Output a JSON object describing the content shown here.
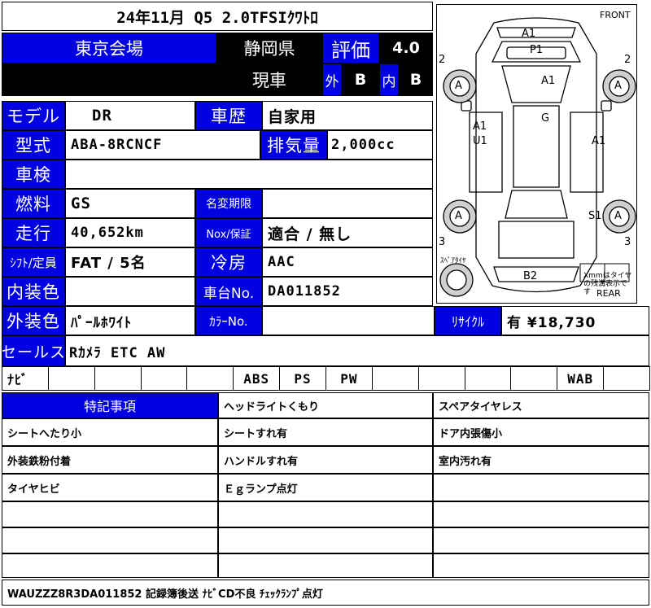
{
  "header": {
    "title": "24年11月 Q5 2.0TFSIｸﾜﾄﾛ"
  },
  "auction": {
    "venue": "東京会場",
    "prefecture": "静岡県",
    "grade_label": "評価",
    "grade": "4.0",
    "status": "現車",
    "exterior_label": "外",
    "exterior": "B",
    "interior_label": "内",
    "interior": "B"
  },
  "spec": {
    "model_label": "モデル",
    "model": "DR",
    "history_label": "車歴",
    "history": "自家用",
    "type_label": "型式",
    "type": "ABA-8RCNCF",
    "displacement_label": "排気量",
    "displacement": "2,000cc",
    "inspection_label": "車検",
    "inspection": "",
    "fuel_label": "燃料",
    "fuel": "GS",
    "transfer_label": "名変期限",
    "transfer": "",
    "mileage_label": "走行",
    "mileage": "40,652km",
    "nox_label": "Nox/保証",
    "nox": "適合 / 無し",
    "shift_label": "ｼﾌﾄ/定員",
    "shift": "FAT / 5名",
    "ac_label": "冷房",
    "ac": "AAC",
    "interior_color_label": "内装色",
    "interior_color": "",
    "chassis_label": "車台No.",
    "chassis": "DA011852",
    "exterior_color_label": "外装色",
    "exterior_color": "ﾊﾟｰﾙﾎﾜｲﾄ",
    "color_no_label": "ｶﾗｰNo.",
    "color_no": "",
    "recycle_label": "ﾘｻｲｸﾙ",
    "recycle": "有 ¥18,730",
    "sales_label": "セールス",
    "sales": "Rｶﾒﾗ ETC AW"
  },
  "equipment": [
    "ﾅﾋﾞ",
    "",
    "",
    "",
    "",
    "ABS",
    "PS",
    "PW",
    "",
    "",
    "",
    "",
    "WAB",
    ""
  ],
  "notes": {
    "header": "特記事項",
    "items": [
      "ヘッドライトくもり",
      "スペアタイヤレス",
      "シートへたり小",
      "シートすれ有",
      "ドア内張傷小",
      "外装鉄粉付着",
      "ハンドルすれ有",
      "室内汚れ有",
      "タイヤヒビ",
      "Ｅｇランプ点灯",
      ""
    ]
  },
  "footer": {
    "remarks": "WAUZZZ8R3DA011852 記録簿後送 ﾅﾋﾞCD不良 ﾁｪｯｸﾗﾝﾌﾟ点灯"
  },
  "diagram": {
    "front": "FRONT",
    "rear": "REAR",
    "marks": {
      "hood_top": "A1",
      "front_panel": "P1",
      "roof": "A1",
      "windshield": "G",
      "left_door_a": "A1",
      "left_door_u": "U1",
      "right_door": "A1",
      "wheel_fl": "A",
      "wheel_fr": "A",
      "wheel_rl": "A",
      "wheel_rr": "A",
      "rear_side": "S1",
      "rear_bumper": "B2",
      "corner_fl": "2",
      "corner_fr": "2",
      "corner_rl": "3",
      "corner_rr": "3"
    },
    "spare_label": "ｽﾍﾟｱﾀｲﾔ",
    "legend": "Xmmはタイヤの残溝表示です"
  }
}
